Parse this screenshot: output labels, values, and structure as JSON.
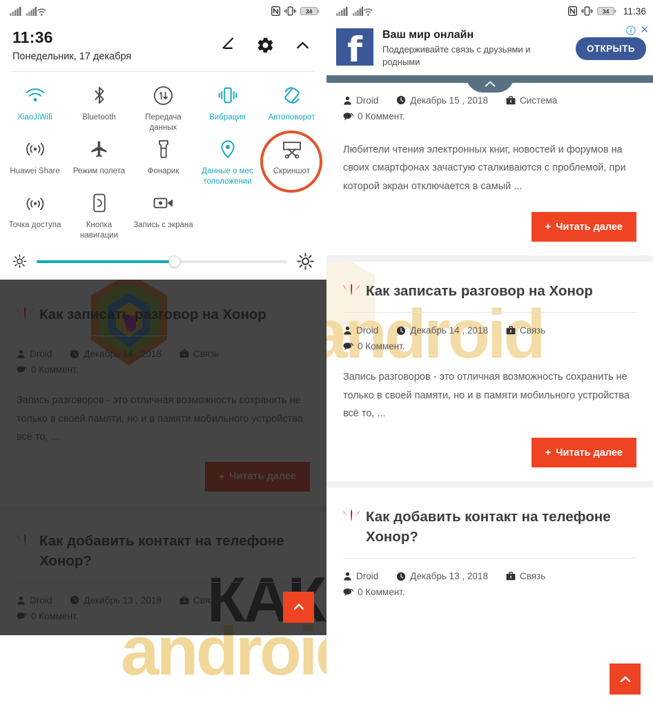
{
  "status_bar": {
    "signal_icon": "signal-bars-icon",
    "signal2_icon": "signal-bars-wifi-icon",
    "nfc_icon": "nfc-icon",
    "vibrate_icon": "vibrate-icon",
    "battery_text": "34",
    "time": "11:36"
  },
  "shade": {
    "time": "11:36",
    "date": "Понедельник, 17 декабря",
    "edit_icon": "pencil-edit-icon",
    "settings_icon": "gear-icon",
    "collapse_icon": "chevron-up-icon",
    "toggles": [
      {
        "label": "XiaoJiWifi",
        "icon": "wifi-icon",
        "active": true
      },
      {
        "label": "Bluetooth",
        "icon": "bluetooth-icon",
        "active": false
      },
      {
        "label": "Передача данных",
        "icon": "mobile-data-icon",
        "active": false
      },
      {
        "label": "Вибрация",
        "icon": "vibration-icon",
        "active": true
      },
      {
        "label": "Автоповорот",
        "icon": "auto-rotate-icon",
        "active": true
      },
      {
        "label": "Huawei Share",
        "icon": "huawei-share-icon",
        "active": false
      },
      {
        "label": "Режим полета",
        "icon": "airplane-icon",
        "active": false
      },
      {
        "label": "Фонарик",
        "icon": "flashlight-icon",
        "active": false
      },
      {
        "label": "Данные о мес тоположении",
        "icon": "location-pin-icon",
        "active": true
      },
      {
        "label": "Скриншот",
        "icon": "screenshot-icon",
        "active": false,
        "highlighted": true
      },
      {
        "label": "Точка доступа",
        "icon": "hotspot-icon",
        "active": false
      },
      {
        "label": "Кнопка навигации",
        "icon": "nav-button-icon",
        "active": false
      },
      {
        "label": "Запись с экрана",
        "icon": "screen-record-icon",
        "active": false
      }
    ],
    "brightness": {
      "low_icon": "brightness-low-icon",
      "high_icon": "brightness-high-icon",
      "value_percent": 55
    },
    "highlight_color": "#e0562c",
    "accent_color": "#18a9bb"
  },
  "ad": {
    "brand_glyph": "f",
    "brand_name": "facebook-logo-icon",
    "title": "Ваш мир онлайн",
    "subtitle": "Поддерживайте связь с друзьями и родными",
    "cta_label": "ОТКРЫТЬ",
    "info_icon": "ad-info-icon",
    "close_icon": "close-icon",
    "brand_color": "#3b5998"
  },
  "pull_tab_icon": "chevron-up-icon",
  "back_to_top_icon": "chevron-up-icon",
  "watermark": {
    "line1": "КАК",
    "line2": "android"
  },
  "articles": [
    {
      "title_prefix": "",
      "title": "",
      "has_logo": false,
      "author": "Droid",
      "author_icon": "user-icon",
      "date": "Декабрь 15 , 2018",
      "date_icon": "clock-icon",
      "category": "Система",
      "category_icon": "briefcase-icon",
      "comments": "0 Коммент.",
      "comments_icon": "comment-icon",
      "excerpt": "Любители чтения электронных книг, новостей и форумов на своих смартфонах зачастую сталкиваются с проблемой, при которой экран отключается в самый ...",
      "more_label": "Читать далее",
      "more_plus": "+"
    },
    {
      "title_prefix": "Как ",
      "title": "записать разговор на Хонор",
      "has_logo": true,
      "logo_icon": "huawei-logo-icon",
      "author": "Droid",
      "author_icon": "user-icon",
      "date": "Декабрь 14 , 2018",
      "date_icon": "clock-icon",
      "category": "Связь",
      "category_icon": "briefcase-icon",
      "comments": "0 Коммент.",
      "comments_icon": "comment-icon",
      "excerpt": "Запись разговоров - это отличная возможность сохранить не только в своей памяти, но и в памяти мобильного устройства всё то, ...",
      "more_label": "Читать далее",
      "more_plus": "+"
    },
    {
      "title_prefix": "",
      "title": "Как добавить контакт на телефоне Хонор?",
      "has_logo": true,
      "logo_icon": "huawei-logo-icon",
      "author": "Droid",
      "author_icon": "user-icon",
      "date": "Декабрь 13 , 2018",
      "date_icon": "clock-icon",
      "category": "Связь",
      "category_icon": "briefcase-icon",
      "comments": "0 Коммент.",
      "comments_icon": "comment-icon"
    }
  ],
  "colors": {
    "accent_teal": "#18a9bb",
    "button_red": "#ef4423",
    "highlight_orange": "#e0562c",
    "shade_bar": "#5b7182",
    "facebook_blue": "#3b5998"
  }
}
